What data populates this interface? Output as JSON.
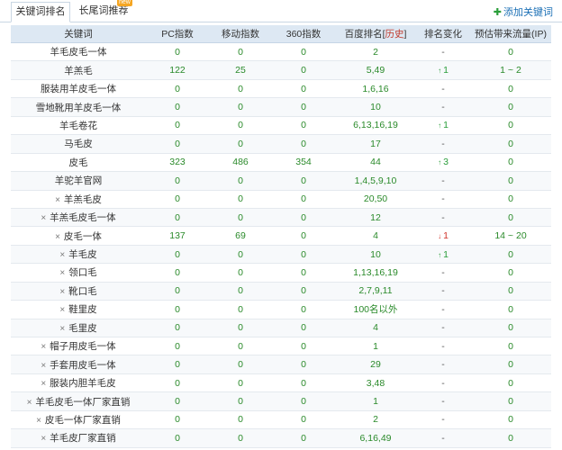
{
  "tabs": {
    "keyword_rank": "关键词排名",
    "longtail": "长尾词推荐",
    "new_badge": "new",
    "add_keyword": "添加关键词"
  },
  "columns": {
    "keyword": "关键词",
    "pc": "PC指数",
    "mobile": "移动指数",
    "s360": "360指数",
    "baidu_prefix": "百度排名[",
    "history": "历史",
    "baidu_suffix": "]",
    "change": "排名变化",
    "traffic": "预估带来流量(IP)"
  },
  "rows": [
    {
      "keyword": "羊毛皮毛一体",
      "del": false,
      "pc": "0",
      "mobile": "0",
      "s360": "0",
      "rank": "2",
      "change": "-",
      "dir": "",
      "traffic": "0"
    },
    {
      "keyword": "羊羔毛",
      "del": false,
      "pc": "122",
      "mobile": "25",
      "s360": "0",
      "rank": "5,49",
      "change": "1",
      "dir": "up",
      "traffic": "1 ~ 2"
    },
    {
      "keyword": "服装用羊皮毛一体",
      "del": false,
      "pc": "0",
      "mobile": "0",
      "s360": "0",
      "rank": "1,6,16",
      "change": "-",
      "dir": "",
      "traffic": "0"
    },
    {
      "keyword": "雪地靴用羊皮毛一体",
      "del": false,
      "pc": "0",
      "mobile": "0",
      "s360": "0",
      "rank": "10",
      "change": "-",
      "dir": "",
      "traffic": "0"
    },
    {
      "keyword": "羊毛卷花",
      "del": false,
      "pc": "0",
      "mobile": "0",
      "s360": "0",
      "rank": "6,13,16,19",
      "change": "1",
      "dir": "up",
      "traffic": "0"
    },
    {
      "keyword": "马毛皮",
      "del": false,
      "pc": "0",
      "mobile": "0",
      "s360": "0",
      "rank": "17",
      "change": "-",
      "dir": "",
      "traffic": "0"
    },
    {
      "keyword": "皮毛",
      "del": false,
      "pc": "323",
      "mobile": "486",
      "s360": "354",
      "rank": "44",
      "change": "3",
      "dir": "up",
      "traffic": "0"
    },
    {
      "keyword": "羊驼羊官网",
      "del": false,
      "pc": "0",
      "mobile": "0",
      "s360": "0",
      "rank": "1,4,5,9,10",
      "change": "-",
      "dir": "",
      "traffic": "0"
    },
    {
      "keyword": "羊羔毛皮",
      "del": true,
      "pc": "0",
      "mobile": "0",
      "s360": "0",
      "rank": "20,50",
      "change": "-",
      "dir": "",
      "traffic": "0"
    },
    {
      "keyword": "羊羔毛皮毛一体",
      "del": true,
      "pc": "0",
      "mobile": "0",
      "s360": "0",
      "rank": "12",
      "change": "-",
      "dir": "",
      "traffic": "0"
    },
    {
      "keyword": "皮毛一体",
      "del": true,
      "pc": "137",
      "mobile": "69",
      "s360": "0",
      "rank": "4",
      "change": "1",
      "dir": "down",
      "traffic": "14 ~ 20"
    },
    {
      "keyword": "羊毛皮",
      "del": true,
      "pc": "0",
      "mobile": "0",
      "s360": "0",
      "rank": "10",
      "change": "1",
      "dir": "up",
      "traffic": "0"
    },
    {
      "keyword": "领口毛",
      "del": true,
      "pc": "0",
      "mobile": "0",
      "s360": "0",
      "rank": "1,13,16,19",
      "change": "-",
      "dir": "",
      "traffic": "0"
    },
    {
      "keyword": "靴口毛",
      "del": true,
      "pc": "0",
      "mobile": "0",
      "s360": "0",
      "rank": "2,7,9,11",
      "change": "-",
      "dir": "",
      "traffic": "0"
    },
    {
      "keyword": "鞋里皮",
      "del": true,
      "pc": "0",
      "mobile": "0",
      "s360": "0",
      "rank": "100名以外",
      "change": "-",
      "dir": "",
      "traffic": "0"
    },
    {
      "keyword": "毛里皮",
      "del": true,
      "pc": "0",
      "mobile": "0",
      "s360": "0",
      "rank": "4",
      "change": "-",
      "dir": "",
      "traffic": "0"
    },
    {
      "keyword": "帽子用皮毛一体",
      "del": true,
      "pc": "0",
      "mobile": "0",
      "s360": "0",
      "rank": "1",
      "change": "-",
      "dir": "",
      "traffic": "0"
    },
    {
      "keyword": "手套用皮毛一体",
      "del": true,
      "pc": "0",
      "mobile": "0",
      "s360": "0",
      "rank": "29",
      "change": "-",
      "dir": "",
      "traffic": "0"
    },
    {
      "keyword": "服装内胆羊毛皮",
      "del": true,
      "pc": "0",
      "mobile": "0",
      "s360": "0",
      "rank": "3,48",
      "change": "-",
      "dir": "",
      "traffic": "0"
    },
    {
      "keyword": "羊毛皮毛一体厂家直销",
      "del": true,
      "pc": "0",
      "mobile": "0",
      "s360": "0",
      "rank": "1",
      "change": "-",
      "dir": "",
      "traffic": "0"
    },
    {
      "keyword": "皮毛一体厂家直销",
      "del": true,
      "pc": "0",
      "mobile": "0",
      "s360": "0",
      "rank": "2",
      "change": "-",
      "dir": "",
      "traffic": "0"
    },
    {
      "keyword": "羊毛皮厂家直销",
      "del": true,
      "pc": "0",
      "mobile": "0",
      "s360": "0",
      "rank": "6,16,49",
      "change": "-",
      "dir": "",
      "traffic": "0"
    }
  ],
  "symbols": {
    "delete": "×",
    "up": "↑",
    "down": "↓"
  },
  "colors": {
    "header_bg": "#dde8f3",
    "number_green": "#2a8a2a",
    "up_green": "#2a9e3a",
    "down_red": "#d0342c",
    "history_red": "#c0392b",
    "link_blue": "#1a6fb5"
  }
}
